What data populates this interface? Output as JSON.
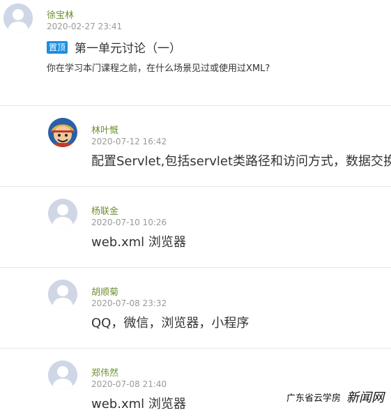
{
  "post": {
    "author": "徐宝林",
    "timestamp": "2020-02-27 23:41",
    "pin_label": "置顶",
    "title": "第一单元讨论（一）",
    "question": "你在学习本门课程之前，在什么场景见过或使用过XML?"
  },
  "replies": [
    {
      "author": "林叶慨",
      "timestamp": "2020-07-12 16:42",
      "content": "配置Servlet,包括servlet类路径和访问方式，数据交换"
    },
    {
      "author": "杨联金",
      "timestamp": "2020-07-10 10:26",
      "content": "web.xml 浏览器"
    },
    {
      "author": "胡顺菊",
      "timestamp": "2020-07-08 23:32",
      "content": "QQ，微信，浏览器，小程序"
    },
    {
      "author": "郑伟然",
      "timestamp": "2020-07-08 21:40",
      "content": "web.xml 浏览器"
    }
  ],
  "watermark": {
    "left": "广东省云学房",
    "right": "新闻网"
  },
  "colors": {
    "author": "#6e8f33",
    "timestamp": "#999999",
    "pin_badge": "#1a8fe0",
    "divider": "#e6e6e6"
  }
}
